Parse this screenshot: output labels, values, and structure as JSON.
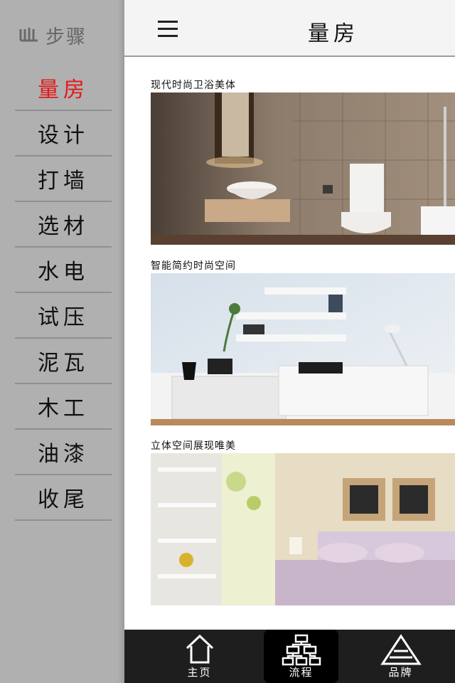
{
  "app": {
    "logo_text": "步骤"
  },
  "header": {
    "title": "量房"
  },
  "sidebar": {
    "items": [
      {
        "label": "量房",
        "active": true
      },
      {
        "label": "设计",
        "active": false
      },
      {
        "label": "打墙",
        "active": false
      },
      {
        "label": "选材",
        "active": false
      },
      {
        "label": "水电",
        "active": false
      },
      {
        "label": "试压",
        "active": false
      },
      {
        "label": "泥瓦",
        "active": false
      },
      {
        "label": "木工",
        "active": false
      },
      {
        "label": "油漆",
        "active": false
      },
      {
        "label": "收尾",
        "active": false
      }
    ]
  },
  "cards": [
    {
      "title": "现代时尚卫浴美体"
    },
    {
      "title": "智能简约时尚空间"
    },
    {
      "title": "立体空间展现唯美"
    }
  ],
  "bottom_nav": {
    "items": [
      {
        "label": "主页",
        "icon": "home-icon"
      },
      {
        "label": "流程",
        "icon": "flowchart-icon",
        "active": true
      },
      {
        "label": "品牌",
        "icon": "pyramid-icon"
      }
    ]
  },
  "colors": {
    "sidebar_bg": "#b0b0b0",
    "active_text": "#e31818",
    "nav_bg": "#1e1e1e"
  }
}
